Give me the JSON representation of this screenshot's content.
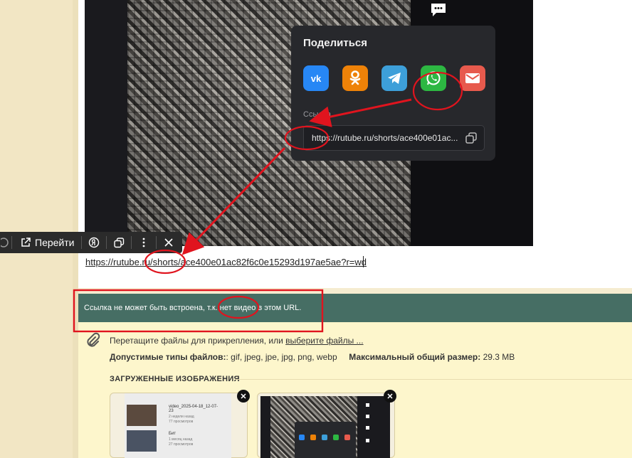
{
  "share": {
    "title": "Поделиться",
    "link_label": "Ссылка",
    "link_value": "https://rutube.ru/shorts/ace400e01ac...",
    "icons": [
      {
        "name": "vk",
        "label": "vk",
        "color": "#2787f5"
      },
      {
        "name": "ok",
        "label": "ок",
        "color": "#ee8208"
      },
      {
        "name": "telegram",
        "label": "",
        "color": "#3d9fd9"
      },
      {
        "name": "whatsapp",
        "label": "",
        "color": "#2db742"
      },
      {
        "name": "mail",
        "label": "",
        "color": "#e75a4d"
      }
    ]
  },
  "toolbar": {
    "go_label": "Перейти"
  },
  "editor": {
    "url": "https://rutube.ru/shorts/ace400e01ac82f6c0e15293d197ae5ae?r=wd"
  },
  "notice": {
    "text": "Ссылка не может быть встроена, т.к. нет видео в этом URL."
  },
  "attachments": {
    "drag_text": "Перетащите файлы для прикрепления, или ",
    "choose_link": "выберите файлы ...",
    "types_label": "Допустимые типы файлов:",
    "types_value": ": gif, jpeg, jpe, jpg, png, webp",
    "max_label": "Максимальный общий размер:",
    "max_value": " 29.3 MB",
    "uploaded_heading": "ЗАГРУЖЕННЫЕ ИЗОБРАЖЕНИЯ"
  },
  "thumb1": {
    "item1_title": "video_2025-04-18_12-07-23",
    "item1_meta": "2 недели назад",
    "item1_views": "77 просмотров",
    "item2_title": "Бит",
    "item2_meta": "1 месяц назад",
    "item2_views": "27 просмотров"
  },
  "colors": {
    "annotation": "#e0141e",
    "notice_bg": "#466e64",
    "attach_bg": "#fdf6cc"
  }
}
